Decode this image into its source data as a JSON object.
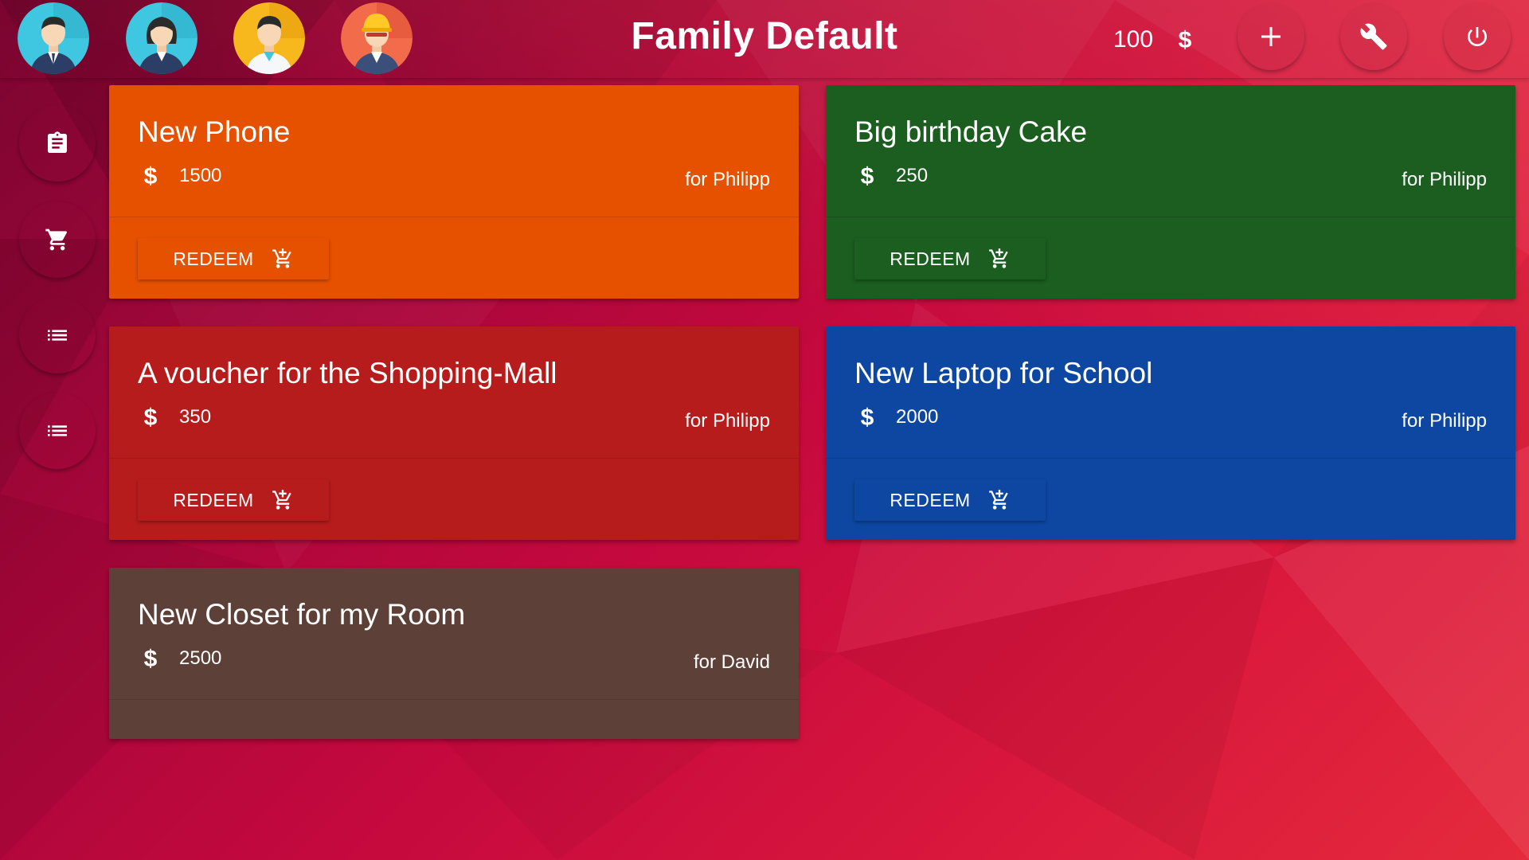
{
  "app": {
    "title": "Family Default"
  },
  "header": {
    "balance": "100",
    "currency_icon": "dollar-icon",
    "actions": [
      {
        "name": "add-button",
        "icon": "plus-icon"
      },
      {
        "name": "settings-button",
        "icon": "wrench-icon"
      },
      {
        "name": "power-button",
        "icon": "power-icon"
      }
    ]
  },
  "avatars": [
    {
      "icon": "man-suit-avatar",
      "color": "#3fc6e0"
    },
    {
      "icon": "woman-suit-avatar",
      "color": "#3fc6e0"
    },
    {
      "icon": "man-doctor-avatar",
      "color": "#f7b81e"
    },
    {
      "icon": "man-helmet-avatar",
      "color": "#f26b4a"
    }
  ],
  "sidebar": [
    {
      "icon": "clipboard-icon"
    },
    {
      "icon": "cart-icon"
    },
    {
      "icon": "list-icon"
    },
    {
      "icon": "list-icon"
    }
  ],
  "rewards": [
    {
      "title": "New Phone",
      "price": "1500",
      "owner": "for Philipp",
      "color": "#e65100",
      "redeem_label": "REDEEM"
    },
    {
      "title": "Big birthday Cake",
      "price": "250",
      "owner": "for Philipp",
      "color": "#1b5e20",
      "redeem_label": "REDEEM"
    },
    {
      "title": "A voucher for the Shopping-Mall",
      "price": "350",
      "owner": "for Philipp",
      "color": "#b71c1c",
      "redeem_label": "REDEEM"
    },
    {
      "title": "New Laptop for School",
      "price": "2000",
      "owner": "for Philipp",
      "color": "#0d47a1",
      "redeem_label": "REDEEM"
    },
    {
      "title": "New Closet for my Room",
      "price": "2500",
      "owner": "for David",
      "color": "#5d4037"
    }
  ]
}
